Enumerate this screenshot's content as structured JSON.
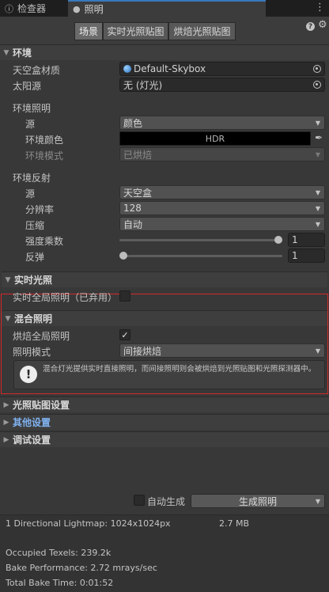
{
  "tabs": [
    {
      "label": "检查器",
      "icon": "info-icon"
    },
    {
      "label": "照明",
      "icon": "lightbulb-icon"
    }
  ],
  "toolbar": {
    "modes": [
      "场景",
      "实时光照贴图",
      "烘焙光照贴图"
    ],
    "selected": "场景"
  },
  "environment": {
    "title": "环境",
    "skybox_label": "天空盒材质",
    "skybox_value": "Default-Skybox",
    "sun_label": "太阳源",
    "sun_value": "无 (灯光)",
    "lighting_group": "环境照明",
    "source_label": "源",
    "source_value": "颜色",
    "color_label": "环境颜色",
    "color_value": "HDR",
    "mode_label": "环境模式",
    "mode_value": "已烘焙",
    "reflection_group": "环境反射",
    "refl_source_label": "源",
    "refl_source_value": "天空盒",
    "resolution_label": "分辨率",
    "resolution_value": "128",
    "compression_label": "压缩",
    "compression_value": "自动",
    "intensity_label": "强度乘数",
    "intensity_value": "1",
    "intensity_fraction": 1.0,
    "bounces_label": "反弹",
    "bounces_value": "1",
    "bounces_fraction": 0.0
  },
  "realtime": {
    "title": "实时光照",
    "gi_label": "实时全局照明（已弃用）",
    "gi_checked": false
  },
  "mixed": {
    "title": "混合照明",
    "baked_gi_label": "烘焙全局照明",
    "baked_gi_checked": true,
    "baked_gi_check": "✓",
    "mode_label": "照明模式",
    "mode_value": "间接烘焙",
    "help_text": "混合灯光提供实时直接照明，而间接照明则会被烘焙到光照贴图和光照探测器中。"
  },
  "collapsed_sections": [
    {
      "title": "光照贴图设置",
      "highlight": false
    },
    {
      "title": "其他设置",
      "highlight": true
    },
    {
      "title": "调试设置",
      "highlight": false
    }
  ],
  "generate": {
    "auto_label": "自动生成",
    "auto_checked": false,
    "button_label": "生成照明"
  },
  "stats": {
    "lightmap": "1 Directional Lightmap: 1024x1024px",
    "size": "2.7 MB",
    "texels": "Occupied Texels: 239.2k",
    "performance": "Bake Performance: 2.72 mrays/sec",
    "bake_time": "Total Bake Time: 0:01:52"
  },
  "colors": {
    "accent": "#3a79bb",
    "highlight_text": "#80b3f2",
    "warning_border": "#d52828",
    "background": "#383838"
  }
}
